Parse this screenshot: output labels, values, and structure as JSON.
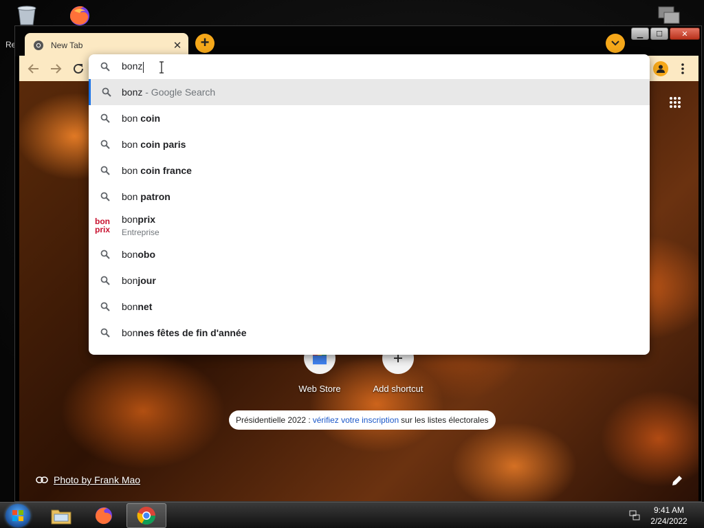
{
  "desktop": {
    "icons": [
      {
        "name": "recycle-bin-icon",
        "label": "Re"
      },
      {
        "name": "firefox-icon"
      },
      {
        "name": "network-icon"
      }
    ]
  },
  "browser": {
    "tab": {
      "title": "New Tab",
      "close_glyph": "✕"
    },
    "new_tab_glyph": "+",
    "window_controls": {
      "minimize": "▁",
      "maximize": "☐",
      "close": "✕"
    },
    "colors": {
      "theme": "#fce9c3",
      "accent": "#f6a81a",
      "link": "#1a57c8"
    }
  },
  "omnibox": {
    "input_value": "bonz",
    "suggestions": [
      {
        "prefix": "bonz",
        "bold": "",
        "sub": " - Google Search",
        "selected": true
      },
      {
        "prefix": "bon ",
        "bold": "coin"
      },
      {
        "prefix": "bon ",
        "bold": "coin paris"
      },
      {
        "prefix": "bon ",
        "bold": "coin france"
      },
      {
        "prefix": "bon ",
        "bold": "patron"
      },
      {
        "prefix": "bon",
        "bold": "prix",
        "entity": true,
        "entity_sub": "Entreprise",
        "logo_top": "bon",
        "logo_bottom": "prix"
      },
      {
        "prefix": "bon",
        "bold": "obo"
      },
      {
        "prefix": "bon",
        "bold": "jour"
      },
      {
        "prefix": "bon",
        "bold": "net"
      },
      {
        "prefix": "bon",
        "bold": "nes fêtes de fin d'année"
      }
    ]
  },
  "new_tab_page": {
    "shortcuts": [
      {
        "label": "Web Store"
      },
      {
        "label": "Add shortcut"
      }
    ],
    "promo": {
      "before": "Présidentielle 2022 :",
      "link": "vérifiez votre inscription",
      "after": "sur les listes électorales"
    },
    "photo_credit": "Photo by Frank Mao"
  },
  "taskbar": {
    "apps": [
      "explorer",
      "firefox",
      "chrome"
    ],
    "clock": {
      "time": "9:41 AM",
      "date": "2/24/2022"
    }
  }
}
